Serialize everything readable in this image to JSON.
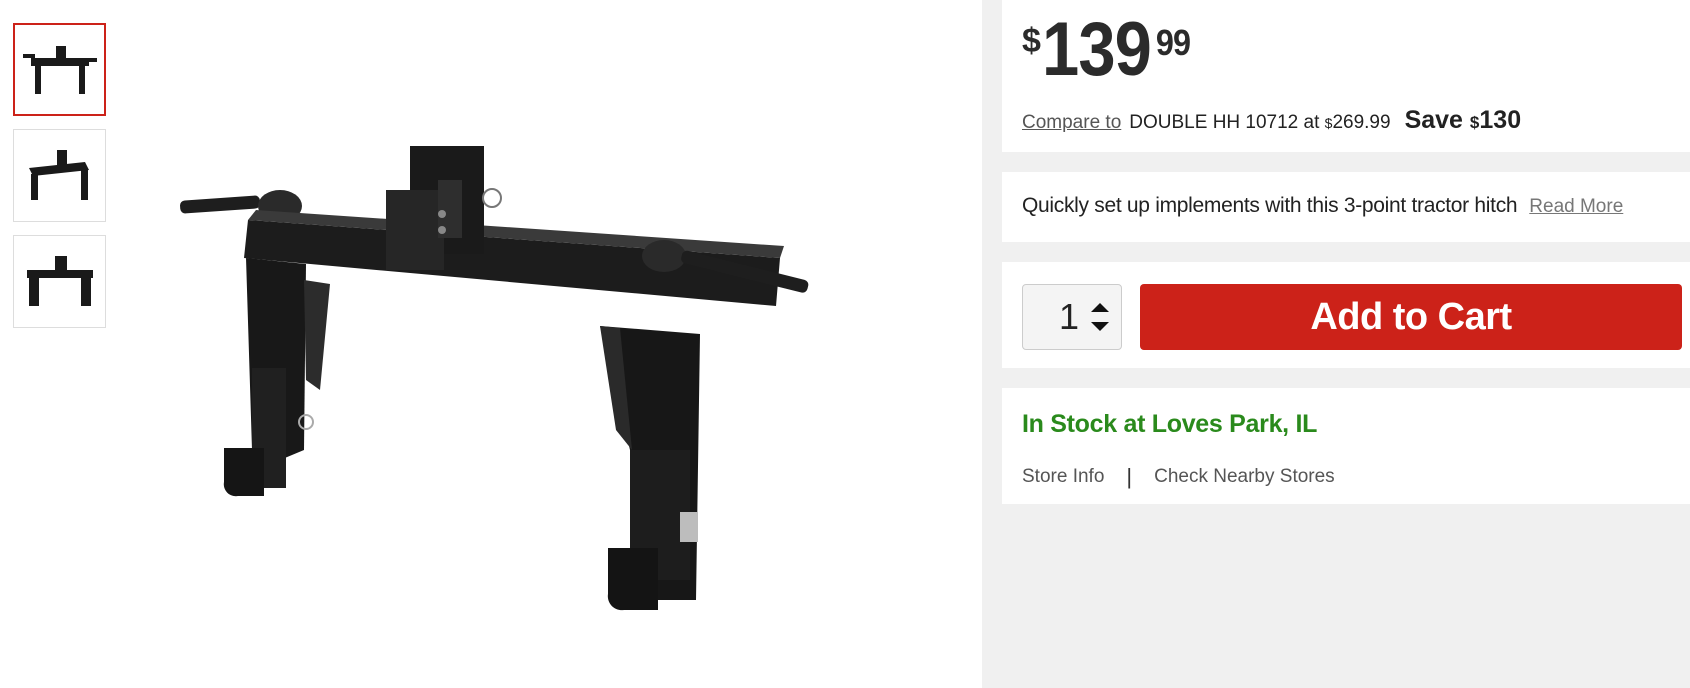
{
  "gallery": {
    "thumbnails": [
      {
        "icon": "hitch-front-view",
        "active": true
      },
      {
        "icon": "hitch-angle-view",
        "active": false
      },
      {
        "icon": "hitch-side-view",
        "active": false
      }
    ],
    "main_image_icon": "three-point-tractor-hitch"
  },
  "price": {
    "currency": "$",
    "dollars": "139",
    "cents": "99"
  },
  "compare": {
    "link_label": "Compare to",
    "text_prefix": "DOUBLE HH 10712 at ",
    "currency": "$",
    "amount": "269.99"
  },
  "save": {
    "label": "Save ",
    "currency": "$",
    "amount": "130"
  },
  "description": {
    "text": "Quickly set up implements with this 3-point tractor hitch",
    "read_more": "Read More"
  },
  "cart": {
    "quantity": "1",
    "add_label": "Add to Cart",
    "button_color": "#cc2219"
  },
  "stock": {
    "status": "In Stock at Loves Park, IL",
    "status_color": "#2a8a1c",
    "store_info": "Store Info",
    "separator": "|",
    "nearby": "Check Nearby Stores"
  }
}
